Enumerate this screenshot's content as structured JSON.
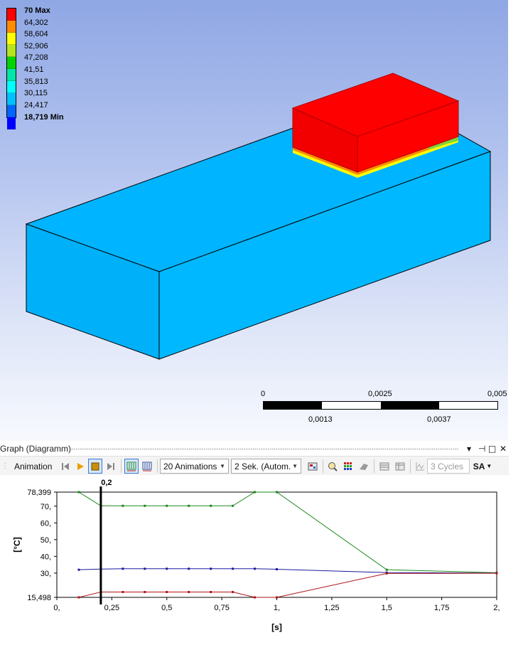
{
  "legend": {
    "colors": [
      "#ff0000",
      "#ff8c00",
      "#ffff00",
      "#b5e61d",
      "#00d400",
      "#00e6a8",
      "#00ffff",
      "#00c0ff",
      "#0066ff",
      "#0000ff"
    ],
    "max_label": "70 Max",
    "labels": [
      "64,302",
      "58,604",
      "52,906",
      "47,208",
      "41,51",
      "35,813",
      "30,115",
      "24,417"
    ],
    "min_label": "18,719 Min"
  },
  "model": {
    "base_color": "#00b4ff",
    "top_color": "#ff0000",
    "edge_yellow": "#ffff00",
    "edge_orange": "#ff8c00",
    "edge_green": "#7cd63c"
  },
  "scale_bar": {
    "top_labels": [
      "0",
      "0,0025",
      "0,005"
    ],
    "bottom_labels": [
      "0,0013",
      "0,0037"
    ]
  },
  "panel": {
    "title": "Graph (Diagramm)",
    "controls": [
      "▾",
      "⊣",
      "□",
      "✕"
    ]
  },
  "toolbar": {
    "animation_label": "Animation",
    "frames_select": "20 Animations",
    "duration_select": "2 Sek. (Autom.",
    "cycles_label": "3 Cycles",
    "sa_label": "SA",
    "icons": [
      "first-frame-icon",
      "play-icon",
      "stop-icon",
      "next-frame-icon",
      "contour-distributed-icon",
      "contour-result-icon",
      "export-video-icon",
      "zoom-fit-icon",
      "legend-color-icon",
      "probe-icon",
      "table-icon",
      "table-export-icon",
      "cycles-icon"
    ]
  },
  "chart_data": {
    "type": "line",
    "ylabel": "[°C]",
    "xlabel": "[s]",
    "xlim": [
      0,
      2
    ],
    "ylim": [
      15.498,
      78.399
    ],
    "x_ticks": [
      {
        "value": 0,
        "label": "0,"
      },
      {
        "value": 0.25,
        "label": "0,25"
      },
      {
        "value": 0.5,
        "label": "0,5"
      },
      {
        "value": 0.75,
        "label": "0,75"
      },
      {
        "value": 1,
        "label": "1,"
      },
      {
        "value": 1.25,
        "label": "1,25"
      },
      {
        "value": 1.5,
        "label": "1,5"
      },
      {
        "value": 1.75,
        "label": "1,75"
      },
      {
        "value": 2,
        "label": "2,"
      }
    ],
    "y_ticks": [
      {
        "value": 78.399,
        "label": "78,399"
      },
      {
        "value": 70,
        "label": "70,"
      },
      {
        "value": 60,
        "label": "60,"
      },
      {
        "value": 50,
        "label": "50,"
      },
      {
        "value": 40,
        "label": "40,"
      },
      {
        "value": 30,
        "label": "30,"
      },
      {
        "value": 15.498,
        "label": "15,498"
      }
    ],
    "cursor": {
      "x": 0.2,
      "label": "0,2"
    },
    "series": [
      {
        "color": "#1a8a1a",
        "x": [
          0.1,
          0.2,
          0.3,
          0.4,
          0.5,
          0.6,
          0.7,
          0.8,
          0.9,
          1.0,
          1.5,
          2.0
        ],
        "y": [
          78.4,
          70.2,
          70.2,
          70.2,
          70.2,
          70.2,
          70.2,
          70.2,
          78.4,
          78.4,
          32.0,
          30.2
        ]
      },
      {
        "color": "#1a1aa0",
        "x": [
          0.1,
          0.2,
          0.3,
          0.4,
          0.5,
          0.6,
          0.7,
          0.8,
          0.9,
          1.0,
          1.5,
          2.0
        ],
        "y": [
          32.0,
          32.4,
          32.6,
          32.6,
          32.6,
          32.6,
          32.6,
          32.6,
          32.6,
          32.3,
          30.3,
          30.0
        ]
      },
      {
        "color": "#b0151a",
        "x": [
          0.1,
          0.2,
          0.3,
          0.4,
          0.5,
          0.6,
          0.7,
          0.8,
          0.9,
          1.0,
          1.5,
          2.0
        ],
        "y": [
          15.5,
          18.7,
          18.7,
          18.7,
          18.7,
          18.7,
          18.7,
          18.7,
          15.5,
          15.5,
          29.8,
          29.9
        ]
      }
    ]
  }
}
